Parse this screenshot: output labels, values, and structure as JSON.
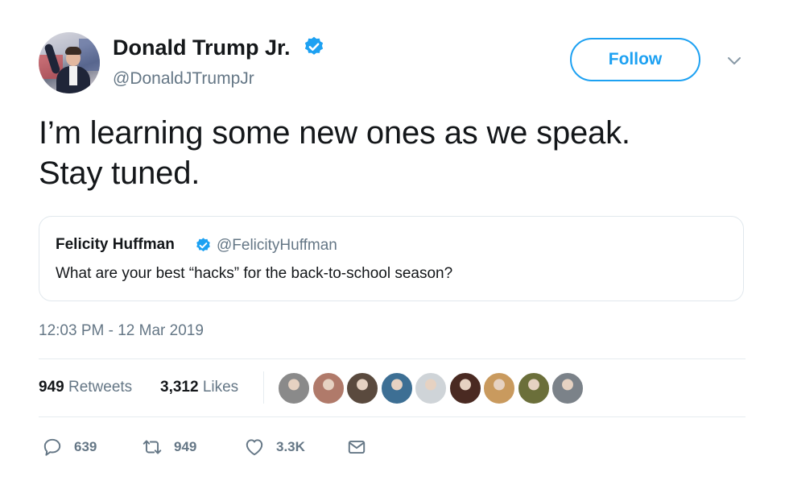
{
  "author": {
    "name": "Donald Trump Jr.",
    "handle": "@DonaldJTrumpJr",
    "verified": true
  },
  "follow_button": {
    "label": "Follow"
  },
  "tweet": {
    "text_line1": "I’m learning some new ones as we speak.",
    "text_line2": "Stay tuned."
  },
  "quoted_tweet": {
    "name": "Felicity Huffman",
    "handle": "@FelicityHuffman",
    "verified": true,
    "text": "What are your best “hacks” for the back-to-school season?"
  },
  "timestamp": "12:03 PM - 12 Mar 2019",
  "stats": {
    "retweets_count": "949",
    "retweets_label": "Retweets",
    "likes_count": "3,312",
    "likes_label": "Likes"
  },
  "likers": [
    {
      "name": "liker-avatar-1",
      "color": "#8a8a8a"
    },
    {
      "name": "liker-avatar-2",
      "color": "#b07a6a"
    },
    {
      "name": "liker-avatar-3",
      "color": "#5a4a3e"
    },
    {
      "name": "liker-avatar-4",
      "color": "#3d6f94"
    },
    {
      "name": "liker-avatar-5",
      "color": "#cfd4d8"
    },
    {
      "name": "liker-avatar-6",
      "color": "#4a2a22"
    },
    {
      "name": "liker-avatar-7",
      "color": "#c99a5e"
    },
    {
      "name": "liker-avatar-8",
      "color": "#6b6f3a"
    },
    {
      "name": "liker-avatar-9",
      "color": "#7b8289"
    }
  ],
  "actions": {
    "reply_count": "639",
    "retweet_count": "949",
    "like_count": "3.3K"
  },
  "colors": {
    "accent": "#1da1f2",
    "text": "#14171a",
    "secondary": "#657786",
    "border": "#e1e8ed"
  },
  "icons": [
    "verified-badge-icon",
    "chevron-down-icon",
    "reply-icon",
    "retweet-icon",
    "heart-icon",
    "direct-message-icon"
  ]
}
